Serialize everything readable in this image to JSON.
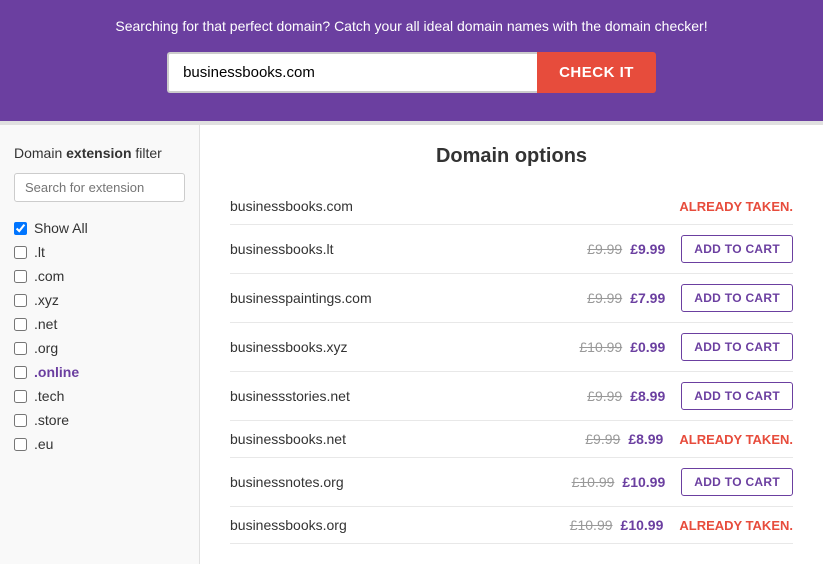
{
  "header": {
    "tagline": "Searching for that perfect domain? Catch your all ideal domain names with the domain checker!",
    "input_value": "businessbooks.com",
    "input_placeholder": "businessbooks.com",
    "check_button_label": "CHECK IT"
  },
  "sidebar": {
    "title_prefix": "Domain ",
    "title_bold": "extension",
    "title_suffix": " filter",
    "search_placeholder": "Search for extension",
    "filters": [
      {
        "label": "Show All",
        "checked": true
      },
      {
        "label": ".lt",
        "checked": false
      },
      {
        "label": ".com",
        "checked": false
      },
      {
        "label": ".xyz",
        "checked": false
      },
      {
        "label": ".net",
        "checked": false
      },
      {
        "label": ".org",
        "checked": false
      },
      {
        "label": ".online",
        "checked": false,
        "highlight": true
      },
      {
        "label": ".tech",
        "checked": false
      },
      {
        "label": ".store",
        "checked": false
      },
      {
        "label": ".eu",
        "checked": false
      }
    ]
  },
  "content": {
    "title": "Domain options",
    "rows": [
      {
        "domain": "businessbooks.com",
        "original": "",
        "sale": "",
        "status": "taken",
        "add_label": ""
      },
      {
        "domain": "businessbooks.lt",
        "original": "£9.99",
        "sale": "£9.99",
        "status": "available",
        "add_label": "ADD TO CART"
      },
      {
        "domain": "businesspaintings.com",
        "original": "£9.99",
        "sale": "£7.99",
        "status": "available",
        "add_label": "ADD TO CART"
      },
      {
        "domain": "businessbooks.xyz",
        "original": "£10.99",
        "sale": "£0.99",
        "status": "available",
        "add_label": "ADD TO CART"
      },
      {
        "domain": "businessstories.net",
        "original": "£9.99",
        "sale": "£8.99",
        "status": "available",
        "add_label": "ADD TO CART"
      },
      {
        "domain": "businessbooks.net",
        "original": "£9.99",
        "sale": "£8.99",
        "status": "taken",
        "add_label": ""
      },
      {
        "domain": "businessnotes.org",
        "original": "£10.99",
        "sale": "£10.99",
        "status": "available",
        "add_label": "ADD TO CART"
      },
      {
        "domain": "businessbooks.org",
        "original": "£10.99",
        "sale": "£10.99",
        "status": "taken",
        "add_label": ""
      }
    ],
    "taken_label": "ALREADY TAKEN."
  },
  "colors": {
    "purple": "#6b3fa0",
    "red": "#e74c3c"
  }
}
